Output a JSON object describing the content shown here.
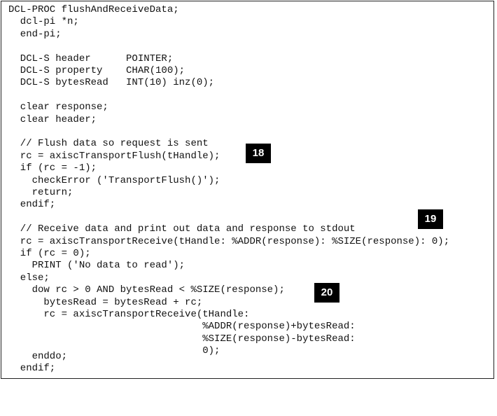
{
  "code_lines": [
    "DCL-PROC flushAndReceiveData;",
    "  dcl-pi *n;",
    "  end-pi;",
    "",
    "  DCL-S header      POINTER;",
    "  DCL-S property    CHAR(100);",
    "  DCL-S bytesRead   INT(10) inz(0);",
    "",
    "  clear response;",
    "  clear header;",
    "",
    "  // Flush data so request is sent",
    "  rc = axiscTransportFlush(tHandle);",
    "  if (rc = -1);",
    "    checkError ('TransportFlush()');",
    "    return;",
    "  endif;",
    "",
    "  // Receive data and print out data and response to stdout",
    "  rc = axiscTransportReceive(tHandle: %ADDR(response): %SIZE(response): 0);",
    "  if (rc = 0);",
    "    PRINT ('No data to read');",
    "  else;",
    "    dow rc > 0 AND bytesRead < %SIZE(response);",
    "      bytesRead = bytesRead + rc;",
    "      rc = axiscTransportReceive(tHandle:",
    "                                 %ADDR(response)+bytesRead:",
    "                                 %SIZE(response)-bytesRead:",
    "                                 0);",
    "",
    "    enddo;",
    "  endif;"
  ],
  "markers": {
    "m18": "18",
    "m19": "19",
    "m20": "20"
  }
}
